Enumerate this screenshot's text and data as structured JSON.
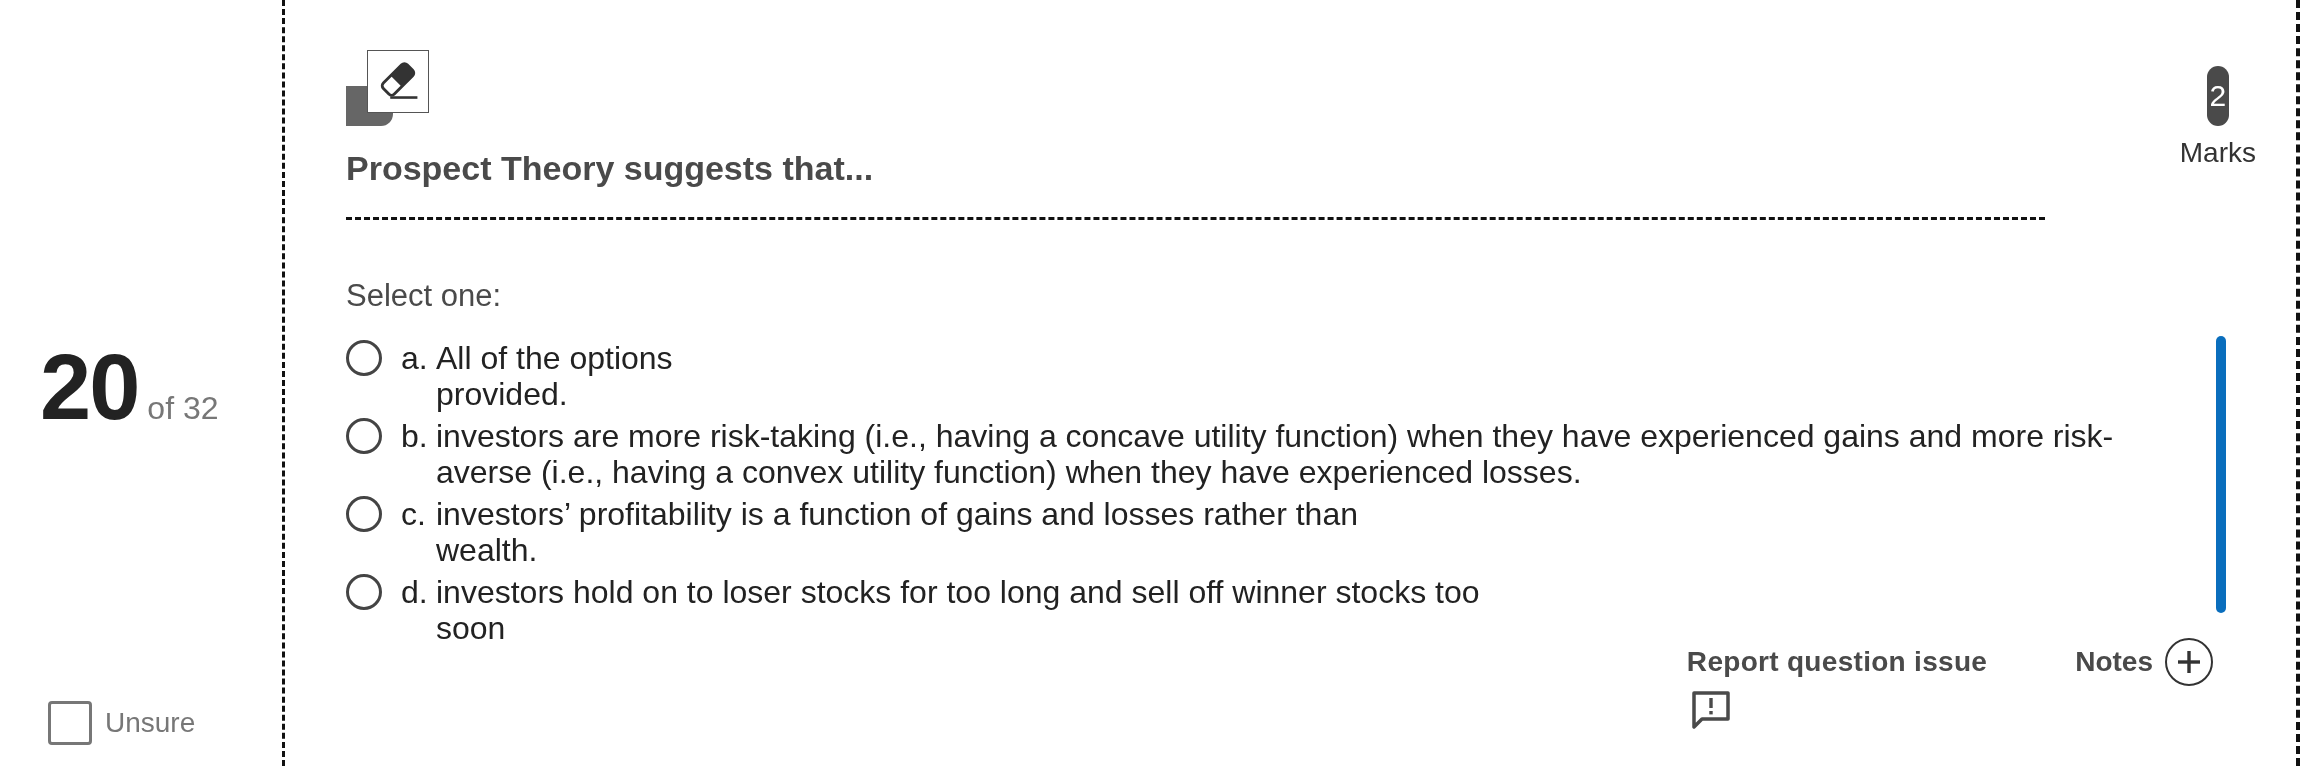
{
  "question": {
    "number": "20",
    "total": "of 32"
  },
  "unsure": {
    "label": "Unsure",
    "checked": false
  },
  "title": "Prospect Theory suggests that...",
  "marks": {
    "value": "2",
    "label": "Marks"
  },
  "prompt": "Select one:",
  "options": [
    {
      "letter": "a.",
      "text": "All of the options provided.",
      "selected": false
    },
    {
      "letter": "b.",
      "text": "investors are more risk-taking (i.e., having a concave utility function) when they have experienced gains and more risk-averse (i.e., having a convex utility function) when they have experienced losses.",
      "selected": false
    },
    {
      "letter": "c.",
      "text": "investors’ profitability is a function of gains and losses rather than wealth.",
      "selected": false
    },
    {
      "letter": "d.",
      "text": "investors hold on to loser stocks for too long and sell off winner stocks too soon",
      "selected": false
    }
  ],
  "footer": {
    "report": "Report question issue",
    "notes": "Notes"
  }
}
